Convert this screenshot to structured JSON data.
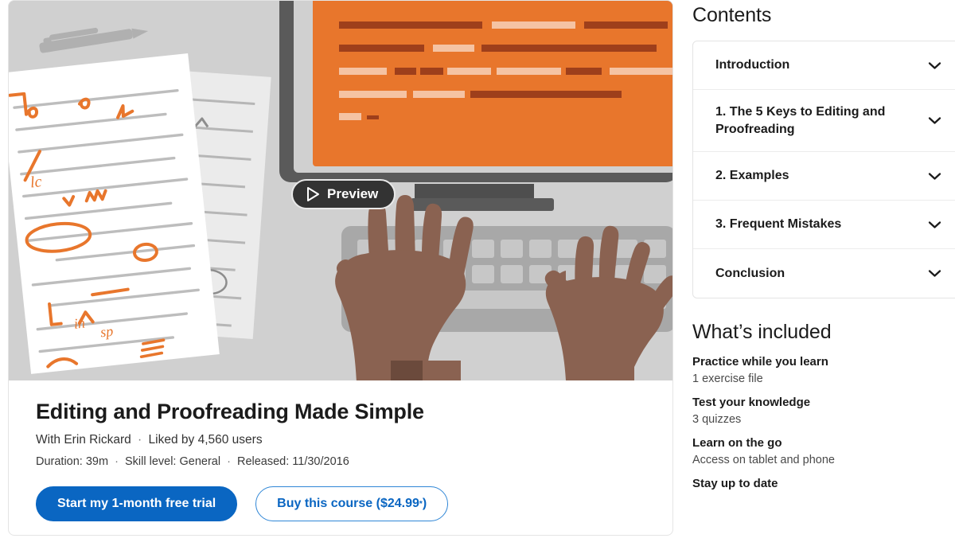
{
  "hero": {
    "preview_label": "Preview",
    "colors": {
      "background": "#d0d0d0",
      "monitor_screen": "#e8762c",
      "monitor_bezel": "#5a5a5a",
      "paper": "#ffffff",
      "proof_mark": "#e8762c",
      "skin": "#8a6251",
      "keyboard": "#a8a8a8"
    }
  },
  "course": {
    "title": "Editing and Proofreading Made Simple",
    "author_prefix": "With",
    "author": "Erin Rickard",
    "likes": "Liked by 4,560 users",
    "duration": "Duration: 39m",
    "skill_level": "Skill level: General",
    "released": "Released: 11/30/2016",
    "separator": "·",
    "primary_cta": "Start my 1-month free trial",
    "secondary_cta": "Buy this course ($24.99",
    "secondary_cta_sup": "*",
    "secondary_cta_end": ")"
  },
  "contents": {
    "heading": "Contents",
    "items": [
      {
        "label": "Introduction"
      },
      {
        "label": "1. The 5 Keys to Editing and Proofreading"
      },
      {
        "label": "2. Examples"
      },
      {
        "label": "3. Frequent Mistakes"
      },
      {
        "label": "Conclusion"
      }
    ]
  },
  "included": {
    "heading": "What’s included",
    "items": [
      {
        "title": "Practice while you learn",
        "sub": "1 exercise file"
      },
      {
        "title": "Test your knowledge",
        "sub": "3 quizzes"
      },
      {
        "title": "Learn on the go",
        "sub": "Access on tablet and phone"
      },
      {
        "title": "Stay up to date",
        "sub": ""
      }
    ]
  },
  "theme": {
    "accent": "#0a66c2",
    "outline": "#2f86d6",
    "orange": "#e8762c"
  }
}
